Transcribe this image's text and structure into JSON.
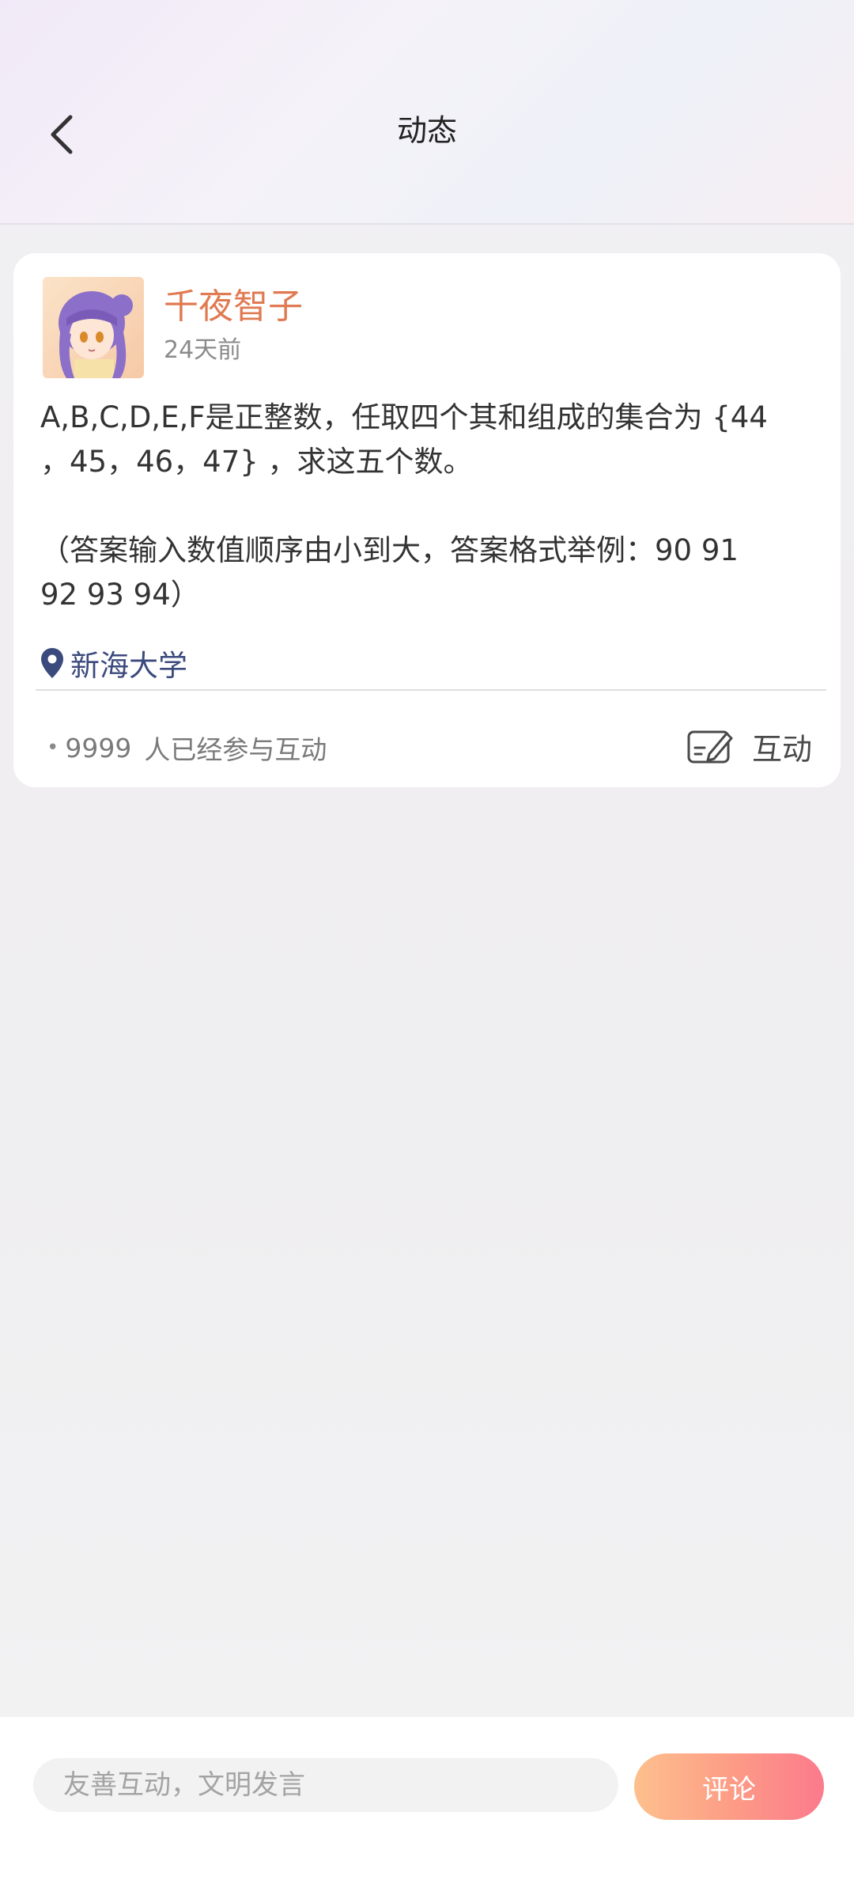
{
  "header": {
    "title": "动态",
    "back_icon": "chevron-left-icon"
  },
  "post": {
    "username": "千夜智子",
    "time_ago": "24天前",
    "content_line1": "A,B,C,D,E,F是正整数，任取四个其和组成的集合为 {44",
    "content_line2": "，45，46，47} ，求这五个数。",
    "content_line3": "（答案输入数值顺序由小到大，答案格式举例：90  91",
    "content_line4": "92  93  94）",
    "location": "新海大学",
    "location_icon": "location-pin-icon",
    "participant_count": "9999",
    "participant_text": "人已经参与互动",
    "interact_label": "互动",
    "interact_icon": "edit-card-icon"
  },
  "comment_bar": {
    "input_placeholder": "友善互动，文明发言",
    "submit_label": "评论"
  },
  "colors": {
    "username": "#e07a52",
    "location": "#3b4a7d",
    "button_gradient_start": "#fdc08d",
    "button_gradient_end": "#fb7a8c"
  }
}
